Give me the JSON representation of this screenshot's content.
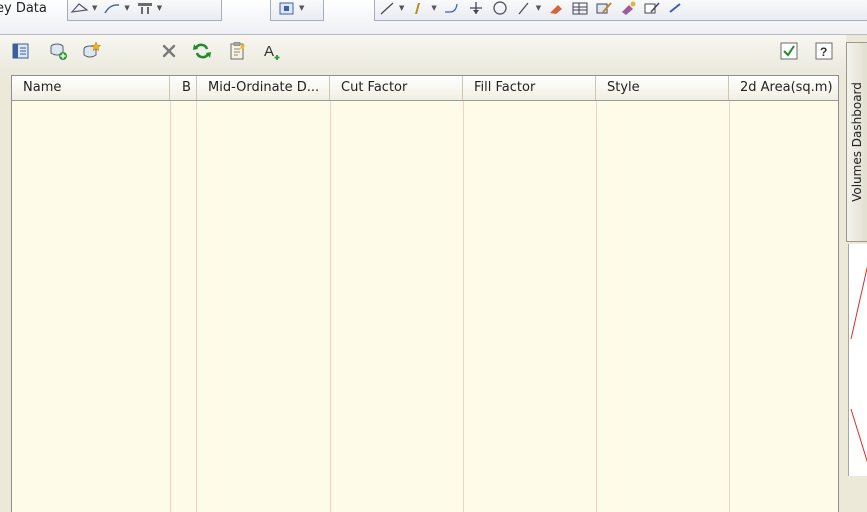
{
  "ribbon": {
    "label": "ey Data"
  },
  "toolbar": {
    "check_label": "✓",
    "help_label": "?"
  },
  "table": {
    "columns": [
      "Name",
      "B",
      "Mid-Ordinate D...",
      "Cut Factor",
      "Fill Factor",
      "Style",
      "2d Area(sq.m)"
    ],
    "rows": []
  },
  "side_tab": {
    "label": "Volumes Dashboard"
  },
  "colors": {
    "grid_background": "#fefce9",
    "grid_lines": "#f0cfcc",
    "panel_background": "#ece9d8"
  }
}
